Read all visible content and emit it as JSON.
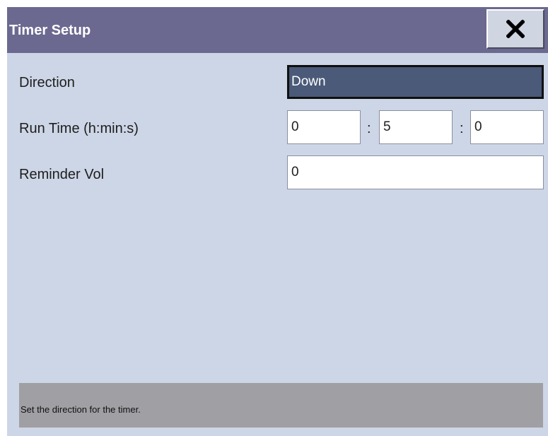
{
  "dialog": {
    "title": "Timer Setup",
    "close_icon": "close-icon"
  },
  "rows": {
    "direction": {
      "label": "Direction",
      "value": "Down"
    },
    "run_time": {
      "label": "Run Time (h:min:s)",
      "hours": "0",
      "separator1": ":",
      "minutes": "5",
      "separator2": ":",
      "seconds": "0"
    },
    "reminder_vol": {
      "label": "Reminder Vol",
      "value": "0"
    }
  },
  "help": {
    "text": "Set the direction for the timer."
  },
  "colors": {
    "titlebar": "#6b6990",
    "background": "#cdd6e6",
    "selected_field": "#4a5a78",
    "help_bar": "#a09fa3"
  }
}
